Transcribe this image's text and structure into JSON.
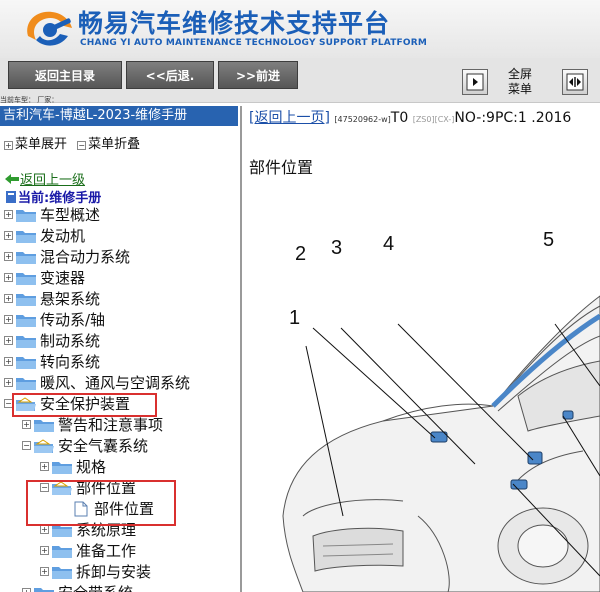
{
  "header": {
    "title": "畅易汽车维修技术支持平台",
    "subtitle": "CHANG YI AUTO MAINTENANCE TECHNOLOGY SUPPORT PLATFORM",
    "brand_color": "#1b5fb8"
  },
  "toolbar": {
    "home_label": "返回主目录",
    "back_label": "<<后退.",
    "forward_label": ">>前进",
    "fullscreen_label_1": "全屏",
    "fullscreen_label_2": "菜单",
    "model_label": "当前车型：   厂家："
  },
  "sidebar": {
    "manual_title": "吉利汽车-博越L-2023-维修手册",
    "expand_label": "菜单展开",
    "collapse_label": "菜单折叠",
    "back_up_label": "返回上一级",
    "current_label": "当前:维修手册",
    "tree": [
      {
        "label": "车型概述",
        "level": 0,
        "state": "collapsed"
      },
      {
        "label": "发动机",
        "level": 0,
        "state": "collapsed"
      },
      {
        "label": "混合动力系统",
        "level": 0,
        "state": "collapsed"
      },
      {
        "label": "变速器",
        "level": 0,
        "state": "collapsed"
      },
      {
        "label": "悬架系统",
        "level": 0,
        "state": "collapsed"
      },
      {
        "label": "传动系/轴",
        "level": 0,
        "state": "collapsed"
      },
      {
        "label": "制动系统",
        "level": 0,
        "state": "collapsed"
      },
      {
        "label": "转向系统",
        "level": 0,
        "state": "collapsed"
      },
      {
        "label": "暖风、通风与空调系统",
        "level": 0,
        "state": "collapsed"
      },
      {
        "label": "安全保护装置",
        "level": 0,
        "state": "expanded",
        "highlighted": true
      },
      {
        "label": "警告和注意事项",
        "level": 1,
        "state": "collapsed"
      },
      {
        "label": "安全气囊系统",
        "level": 1,
        "state": "expanded"
      },
      {
        "label": "规格",
        "level": 2,
        "state": "collapsed"
      },
      {
        "label": "部件位置",
        "level": 2,
        "state": "expanded",
        "highlighted": true
      },
      {
        "label": "部件位置",
        "level": 3,
        "state": "page",
        "highlighted": true
      },
      {
        "label": "系统原理",
        "level": 2,
        "state": "collapsed"
      },
      {
        "label": "准备工作",
        "level": 2,
        "state": "collapsed"
      },
      {
        "label": "拆卸与安装",
        "level": 2,
        "state": "collapsed"
      },
      {
        "label": "安全带系统",
        "level": 1,
        "state": "collapsed"
      }
    ]
  },
  "content": {
    "back_link": "[返回上一页]",
    "code": "[47520962-w]",
    "t0": "T0",
    "zs": "[ZS0][CX-]",
    "no_text": "NO-:9PC:1 .2016",
    "section_title": "部件位置",
    "callouts": [
      "1",
      "2",
      "3",
      "4",
      "5"
    ]
  },
  "colors": {
    "title_bar": "#2863b0",
    "highlight": "#d9302f",
    "airbag_part": "#4a86c8"
  }
}
